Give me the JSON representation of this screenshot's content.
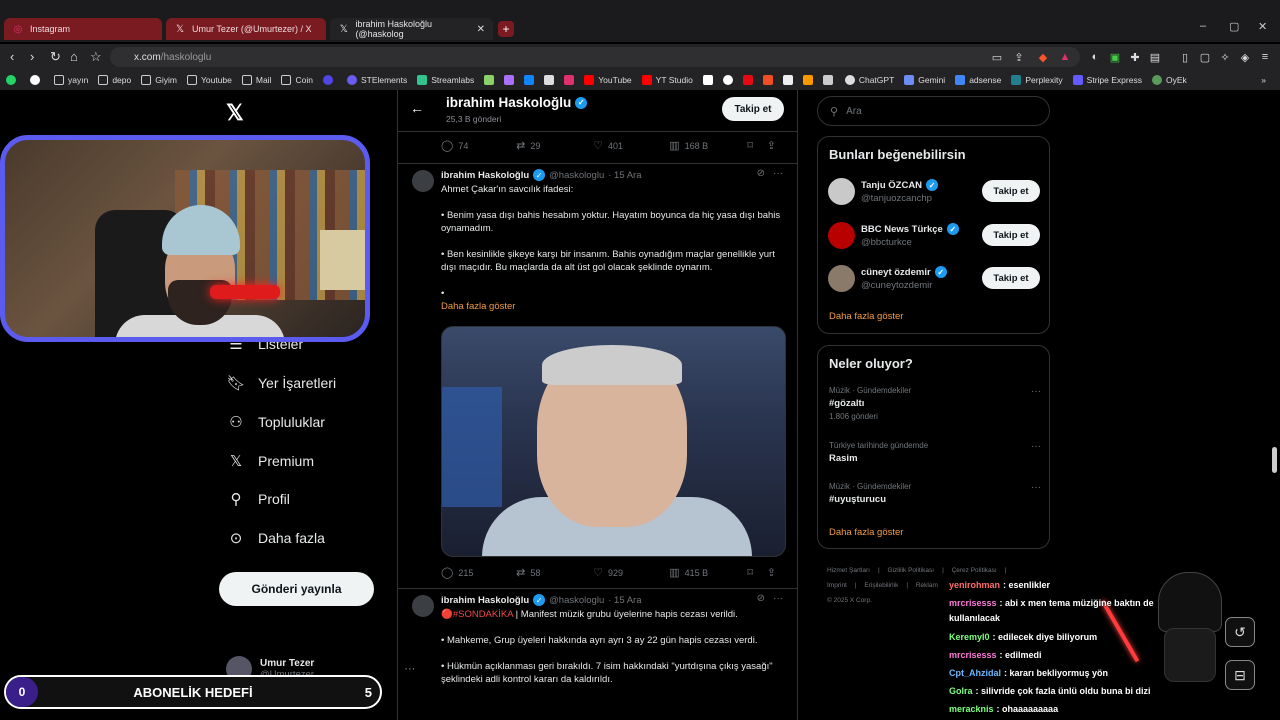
{
  "browser": {
    "tabs": [
      {
        "label": "Instagram",
        "icon": "instagram-icon"
      },
      {
        "label": "Umur Tezer (@Umurtezer) / X",
        "icon": "x-icon"
      },
      {
        "label": "ibrahim Haskoloğlu (@haskolog",
        "icon": "x-icon"
      }
    ],
    "new_tab": "+",
    "url_host": "x.com",
    "url_path": "/haskologlu",
    "bookmarks": [
      "yayın",
      "depo",
      "Giyim",
      "Youtube",
      "Mail",
      "Coin",
      "STElements",
      "Streamlabs",
      "YouTube",
      "YT Studio",
      "ChatGPT",
      "Gemini",
      "adsense",
      "Perplexity",
      "Stripe Express",
      "OyEk"
    ]
  },
  "nav": {
    "items": [
      "Listeler",
      "Yer İşaretleri",
      "Topluluklar",
      "Premium",
      "Profil",
      "Daha fazla"
    ],
    "post_button": "Gönderi yayınla",
    "user_name": "Umur Tezer",
    "user_handle": "@Umurtezer",
    "user_more": "···"
  },
  "profile_header": {
    "name": "ibrahim Haskoloğlu",
    "posts": "25,3 B gönderi",
    "follow": "Takip et"
  },
  "top_actions": {
    "replies": "74",
    "reposts": "29",
    "likes": "401",
    "views": "168 B"
  },
  "tweet1": {
    "name": "ibrahim Haskoloğlu",
    "handle": "@haskologlu",
    "date": "· 15 Ara",
    "p1": "Ahmet Çakar'ın savcılık ifadesi:",
    "p2": "• Benim yasa dışı bahis hesabım yoktur. Hayatım boyunca da hiç yasa dışı bahis oynamadım.",
    "p3": "• Ben kesinlikle şikeye karşı bir insanım. Bahis oynadığım maçlar genellikle yurt dışı maçıdır. Bu maçlarda da alt üst gol olacak şeklinde oynarım.",
    "p4": "•",
    "show_more": "Daha fazla göster",
    "replies": "215",
    "reposts": "58",
    "likes": "929",
    "views": "415 B"
  },
  "tweet2": {
    "name": "ibrahim Haskoloğlu",
    "handle": "@haskologlu",
    "date": "· 15 Ara",
    "tag": "🔴#SONDAKİKA",
    "p1": " | Manifest müzik grubu üyelerine hapis cezası verildi.",
    "p2": "• Mahkeme, Grup üyeleri hakkında ayrı ayrı 3 ay 22 gün hapis cezası verdi.",
    "p3": "• Hükmün açıklanması geri bırakıldı. 7 isim hakkındaki \"yurtdışına çıkış yasağı\" şeklindeki adli kontrol kararı da kaldırıldı."
  },
  "search": {
    "placeholder": "Ara"
  },
  "suggest": {
    "title": "Bunları beğenebilirsin",
    "people": [
      {
        "name": "Tanju ÖZCAN",
        "handle": "@tanjuozcanchp",
        "follow": "Takip et",
        "color": "#c9c9c9"
      },
      {
        "name": "BBC News Türkçe",
        "handle": "@bbcturkce",
        "follow": "Takip et",
        "color": "#b80000"
      },
      {
        "name": "cüneyt özdemir",
        "handle": "@cuneytozdemir",
        "follow": "Takip et",
        "color": "#8a7a6a"
      }
    ],
    "show_more": "Daha fazla göster"
  },
  "trends": {
    "title": "Neler oluyor?",
    "items": [
      {
        "cat": "Müzik · Gündemdekiler",
        "topic": "#gözaltı",
        "count": "1.806 gönderi"
      },
      {
        "cat": "Türkiye tarihinde gündemde",
        "topic": "Rasim",
        "count": ""
      },
      {
        "cat": "Müzik · Gündemdekiler",
        "topic": "#uyuşturucu",
        "count": ""
      }
    ],
    "show_more": "Daha fazla göster"
  },
  "footer": {
    "links": [
      "Hizmet Şartları",
      "Gizlilik Politikası",
      "Çerez Politikası",
      "Imprint",
      "Erişilebilirlik",
      "Reklam"
    ],
    "copyright": "© 2025 X Corp."
  },
  "chat": [
    {
      "user": "yenirohman",
      "msg": ": esenlikler",
      "color": "#ff6a6a"
    },
    {
      "user": "mrcrisesss",
      "msg": ": abi x men tema müziğine baktın de",
      "color": "#ff7ad9"
    },
    {
      "user": "",
      "msg": "kullanılacak",
      "color": "#ffffff"
    },
    {
      "user": "Keremyl0",
      "msg": ": edilecek diye biliyorum",
      "color": "#7dff7d"
    },
    {
      "user": "mrcrisesss",
      "msg": ": edilmedi",
      "color": "#ff7ad9"
    },
    {
      "user": "Cpt_Ahzidal",
      "msg": ": kararı bekliyormuş yön",
      "color": "#6ab8ff"
    },
    {
      "user": "Golra",
      "msg": ": silivride çok fazla ünlü oldu buna bi dizi",
      "color": "#7dff7d"
    },
    {
      "user": "meracknis",
      "msg": ": ohaaaaaaaaa",
      "color": "#7dff7d"
    }
  ],
  "subgoal": {
    "start": "0",
    "label": "ABONELİK HEDEFİ",
    "end": "5"
  },
  "window": {
    "minimize": "–",
    "maximize": "▢",
    "close": "✕"
  }
}
